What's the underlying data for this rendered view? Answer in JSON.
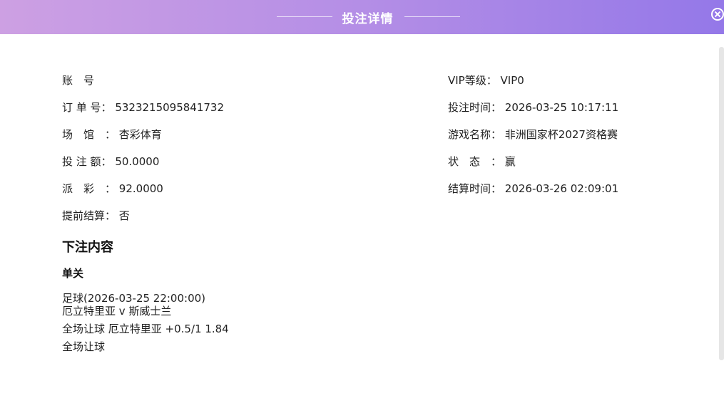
{
  "dialog": {
    "title": "投注详情"
  },
  "left_fields": [
    {
      "label": "账　号",
      "value": ""
    },
    {
      "label": "订 单 号：",
      "value": "5323215095841732"
    },
    {
      "label": "场　馆　：",
      "value": "杏彩体育"
    },
    {
      "label": "投 注 额：",
      "value": "50.0000"
    },
    {
      "label": "派　彩　：",
      "value": "92.0000"
    },
    {
      "label": "提前结算：",
      "value": "否"
    }
  ],
  "right_fields": [
    {
      "label": "VIP等级：",
      "value": "VIP0"
    },
    {
      "label": "投注时间：",
      "value": "2026-03-25 10:17:11"
    },
    {
      "label": "游戏名称：",
      "value": "非洲国家杯2027资格赛"
    },
    {
      "label": "状　态　：",
      "value": "赢"
    },
    {
      "label": "结算时间：",
      "value": "2026-03-26 02:09:01"
    }
  ],
  "bet_content": {
    "heading": "下注内容",
    "type": "单关",
    "lines": [
      "足球(2026-03-25 22:00:00)",
      "厄立特里亚 v 斯威士兰",
      "全场让球 厄立特里亚 +0.5/1 1.84",
      "全场让球"
    ]
  }
}
